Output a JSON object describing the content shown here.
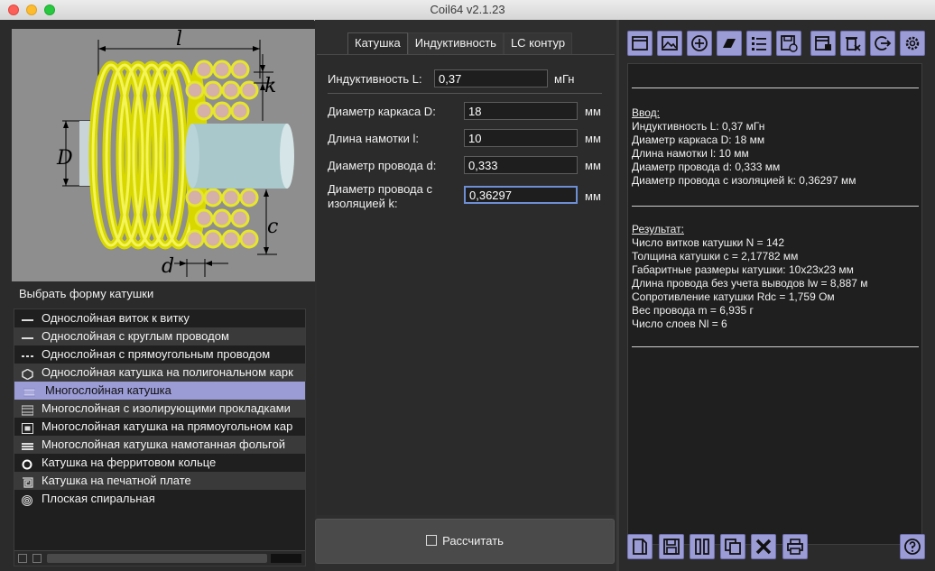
{
  "window": {
    "title": "Coil64 v2.1.23"
  },
  "left": {
    "choose_label": "Выбрать форму катушки",
    "image_labels": {
      "l": "l",
      "k": "k",
      "D": "D",
      "c": "c",
      "d": "d"
    },
    "coil_types": [
      {
        "label": "Однослойная виток к витку",
        "icon": "single-layer-icon"
      },
      {
        "label": "Однослойная с круглым проводом",
        "icon": "round-wire-icon"
      },
      {
        "label": "Однослойная с прямоугольным проводом",
        "icon": "rect-wire-icon"
      },
      {
        "label": "Однослойная катушка на полигональном карк",
        "icon": "polygon-icon"
      },
      {
        "label": "Многослойная катушка",
        "icon": "multilayer-icon",
        "selected": true
      },
      {
        "label": "Многослойная с изолирующими прокладками",
        "icon": "gap-icon"
      },
      {
        "label": "Многослойная катушка на прямоугольном кар",
        "icon": "rect-core-icon"
      },
      {
        "label": "Многослойная катушка намотанная фольгой",
        "icon": "foil-icon"
      },
      {
        "label": "Катушка на ферритовом кольце",
        "icon": "ring-icon"
      },
      {
        "label": "Катушка на печатной плате",
        "icon": "pcb-icon"
      },
      {
        "label": "Плоская спиральная",
        "icon": "spiral-icon"
      }
    ]
  },
  "tabs": [
    "Катушка",
    "Индуктивность",
    "LC контур"
  ],
  "form": {
    "inductance": {
      "label": "Индуктивность L:",
      "value": "0,37",
      "unit": "мГн"
    },
    "former_diameter": {
      "label": "Диаметр каркаса D:",
      "value": "18",
      "unit": "мм"
    },
    "winding_length": {
      "label": "Длина намотки l:",
      "value": "10",
      "unit": "мм"
    },
    "wire_diameter": {
      "label": "Диаметр провода d:",
      "value": "0,333",
      "unit": "мм"
    },
    "insulated_diameter": {
      "label_line1": "Диаметр провода с",
      "label_line2": "изоляцией k:",
      "value": "0,36297",
      "unit": "мм"
    },
    "calculate_label": "Рассчитать"
  },
  "output": {
    "input_header": "Ввод:",
    "input_lines": [
      "Индуктивность L: 0,37 мГн",
      "Диаметр каркаса D: 18 мм",
      "Длина намотки l: 10 мм",
      "Диаметр провода d: 0,333 мм",
      "Диаметр провода с изоляцией k: 0,36297 мм"
    ],
    "result_header": "Результат:",
    "result_lines": [
      "Число витков катушки N = 142",
      "Толщина катушки c = 2,17782 мм",
      "Габаритные размеры катушки: 10x23x23 мм",
      "Длина провода без учета выводов lw = 8,887 м",
      "Сопротивление катушки Rdc = 1,759 Ом",
      "Вес провода m = 6,935 г",
      "Число слоев Nl = 6"
    ]
  },
  "toolbar": [
    "window-icon",
    "image-icon",
    "plus-circle-icon",
    "eraser-icon",
    "list-icon",
    "save-check-icon",
    "calendar-delete-icon",
    "delete-all-icon",
    "exit-icon",
    "settings-icon"
  ],
  "bottom_toolbar": [
    "open-icon",
    "save-icon",
    "columns-icon",
    "copy-icon",
    "clear-icon",
    "print-icon",
    "help-icon"
  ],
  "colors": {
    "accent": "#9b9bd6",
    "coil": "#e6e62a",
    "background": "#2b2b2b"
  }
}
